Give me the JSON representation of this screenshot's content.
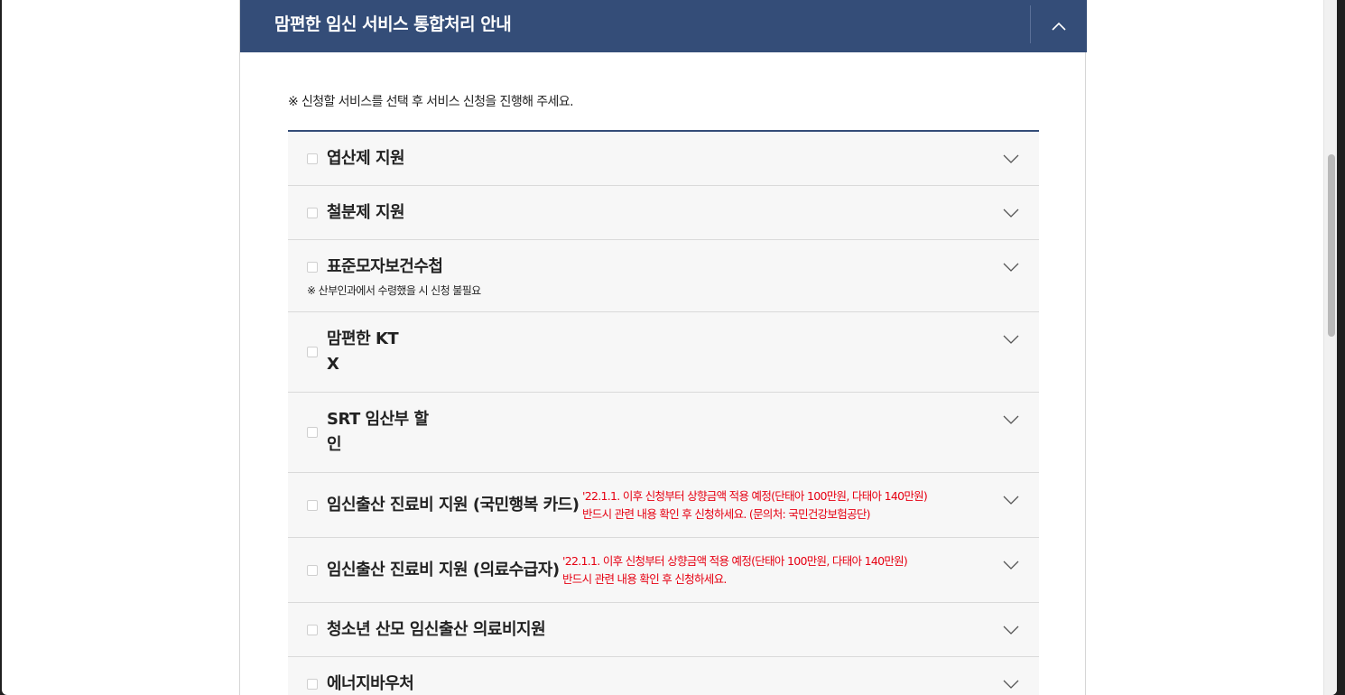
{
  "panel": {
    "title": "맘편한 임신 서비스 통합처리 안내",
    "notice": "※ 신청할 서비스를 선택 후 서비스 신청을 진행해 주세요."
  },
  "services": [
    {
      "label": "엽산제 지원"
    },
    {
      "label": "철분제 지원"
    },
    {
      "label": "표준모자보건수첩",
      "sub": "※ 산부인과에서 수령했을 시 신청 불필요"
    },
    {
      "label_line1": "맘편한 KT",
      "label_line2": "X"
    },
    {
      "label_line1": "SRT 임산부 할",
      "label_line2": "인"
    },
    {
      "label": "임신출산 진료비 지원 (국민행복 카드)",
      "note_line1": "'22.1.1. 이후 신청부터 상향금액 적용 예정(단태아 100만원, 다태아 140만원)",
      "note_line2": "반드시 관련 내용 확인 후 신청하세요. (문의처: 국민건강보험공단)"
    },
    {
      "label": "임신출산 진료비 지원 (의료수급자)",
      "note_line1": "'22.1.1. 이후 신청부터 상향금액 적용 예정(단태아 100만원, 다태아 140만원)",
      "note_line2": "반드시 관련 내용 확인 후 신청하세요."
    },
    {
      "label": "청소년 산모 임신출산 의료비지원"
    },
    {
      "label": "에너지바우처"
    }
  ],
  "icons": {
    "collapse": "chevron-up-icon",
    "expand": "chevron-down-icon"
  },
  "colors": {
    "header_bg": "#344d78",
    "note_red": "#e60012",
    "row_bg": "#f7f7f7"
  }
}
